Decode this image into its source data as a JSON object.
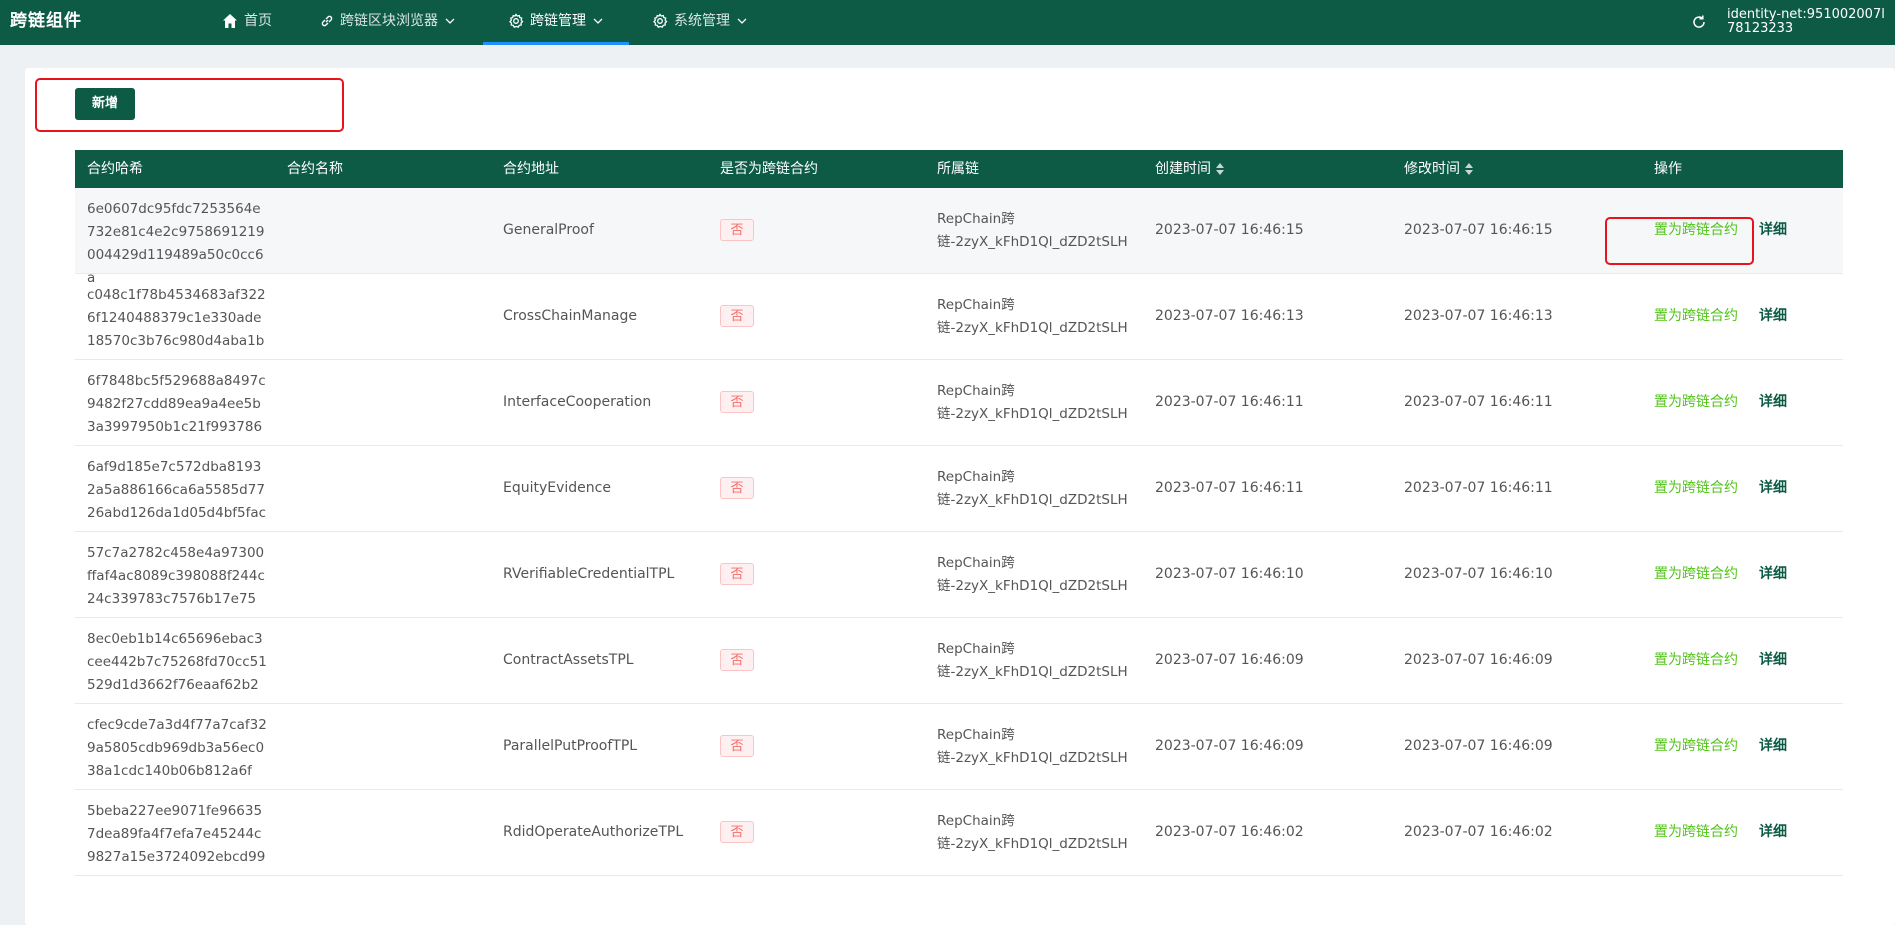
{
  "app": {
    "title": "跨链组件",
    "identity": "identity-net:951002007l78123233"
  },
  "nav": [
    {
      "label": "首页",
      "icon": "home-icon"
    },
    {
      "label": "跨链区块浏览器",
      "icon": "link-icon"
    },
    {
      "label": "跨链管理",
      "icon": "gear-icon"
    },
    {
      "label": "系统管理",
      "icon": "gear-icon"
    }
  ],
  "toolbar": {
    "add_label": "新增"
  },
  "table": {
    "columns": [
      "合约哈希",
      "合约名称",
      "合约地址",
      "是否为跨链合约",
      "所属链",
      "创建时间",
      "修改时间",
      "操作"
    ],
    "rows": [
      {
        "hash": "6e0607dc95fdc7253564e732e81c4e2c9758691219004429d119489a50c0cc6a",
        "name": "",
        "address": "GeneralProof",
        "is_cross": "否",
        "chain": "RepChain跨链-2zyX_kFhD1Ql_dZD2tSLH",
        "created": "2023-07-07 16:46:15",
        "modified": "2023-07-07 16:46:15",
        "op_set": "置为跨链合约",
        "op_detail": "详细"
      },
      {
        "hash": "c048c1f78b4534683af3226f1240488379c1e330ade18570c3b76c980d4aba1b",
        "name": "",
        "address": "CrossChainManage",
        "is_cross": "否",
        "chain": "RepChain跨链-2zyX_kFhD1Ql_dZD2tSLH",
        "created": "2023-07-07 16:46:13",
        "modified": "2023-07-07 16:46:13",
        "op_set": "置为跨链合约",
        "op_detail": "详细"
      },
      {
        "hash": "6f7848bc5f529688a8497c9482f27cdd89ea9a4ee5b3a3997950b1c21f993786",
        "name": "",
        "address": "InterfaceCooperation",
        "is_cross": "否",
        "chain": "RepChain跨链-2zyX_kFhD1Ql_dZD2tSLH",
        "created": "2023-07-07 16:46:11",
        "modified": "2023-07-07 16:46:11",
        "op_set": "置为跨链合约",
        "op_detail": "详细"
      },
      {
        "hash": "6af9d185e7c572dba81932a5a886166ca6a5585d7726abd126da1d05d4bf5fac",
        "name": "",
        "address": "EquityEvidence",
        "is_cross": "否",
        "chain": "RepChain跨链-2zyX_kFhD1Ql_dZD2tSLH",
        "created": "2023-07-07 16:46:11",
        "modified": "2023-07-07 16:46:11",
        "op_set": "置为跨链合约",
        "op_detail": "详细"
      },
      {
        "hash": "57c7a2782c458e4a97300ffaf4ac8089c398088f244c24c339783c7576b17e75",
        "name": "",
        "address": "RVerifiableCredentialTPL",
        "is_cross": "否",
        "chain": "RepChain跨链-2zyX_kFhD1Ql_dZD2tSLH",
        "created": "2023-07-07 16:46:10",
        "modified": "2023-07-07 16:46:10",
        "op_set": "置为跨链合约",
        "op_detail": "详细"
      },
      {
        "hash": "8ec0eb1b14c65696ebac3cee442b7c75268fd70cc51529d1d3662f76eaaf62b2",
        "name": "",
        "address": "ContractAssetsTPL",
        "is_cross": "否",
        "chain": "RepChain跨链-2zyX_kFhD1Ql_dZD2tSLH",
        "created": "2023-07-07 16:46:09",
        "modified": "2023-07-07 16:46:09",
        "op_set": "置为跨链合约",
        "op_detail": "详细"
      },
      {
        "hash": "cfec9cde7a3d4f77a7caf329a5805cdb969db3a56ec038a1cdc140b06b812a6f",
        "name": "",
        "address": "ParallelPutProofTPL",
        "is_cross": "否",
        "chain": "RepChain跨链-2zyX_kFhD1Ql_dZD2tSLH",
        "created": "2023-07-07 16:46:09",
        "modified": "2023-07-07 16:46:09",
        "op_set": "置为跨链合约",
        "op_detail": "详细"
      },
      {
        "hash": "5beba227ee9071fe966357dea89fa4f7efa7e45244c9827a15e3724092ebcd99",
        "name": "",
        "address": "RdidOperateAuthorizeTPL",
        "is_cross": "否",
        "chain": "RepChain跨链-2zyX_kFhD1Ql_dZD2tSLH",
        "created": "2023-07-07 16:46:02",
        "modified": "2023-07-07 16:46:02",
        "op_set": "置为跨链合约",
        "op_detail": "详细"
      }
    ]
  },
  "colors": {
    "brand": "#0d5b45",
    "accent": "#1e90ff",
    "highlight_box": "#e8141a",
    "tag_red": "#f56c6c",
    "link_green": "#52c41a"
  }
}
